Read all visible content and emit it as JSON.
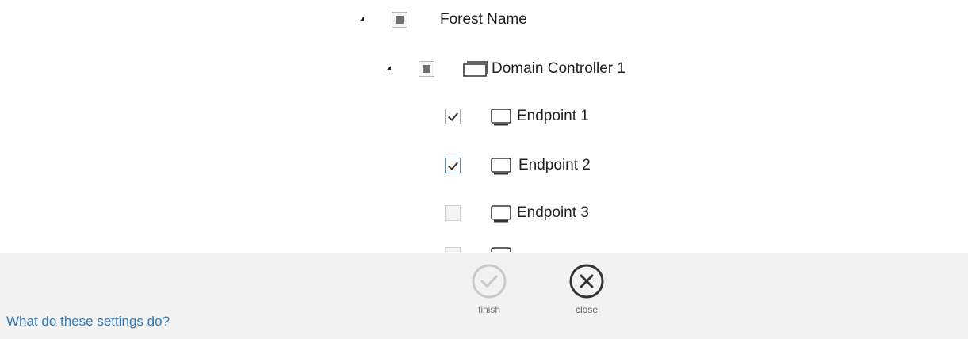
{
  "tree": {
    "forest": {
      "label": "Forest Name",
      "expanded": true,
      "state": "partial"
    },
    "domain_controller": {
      "label": "Domain Controller 1",
      "expanded": true,
      "state": "partial",
      "icon": "folder-icon"
    },
    "endpoints": [
      {
        "label": "Endpoint 1",
        "state": "checked",
        "icon": "computer-icon"
      },
      {
        "label": "Endpoint 2",
        "state": "checked",
        "icon": "computer-icon"
      },
      {
        "label": "Endpoint 3",
        "state": "unchecked",
        "icon": "computer-icon"
      }
    ]
  },
  "footer": {
    "help_link": "What do these settings do?",
    "finish_label": "finish",
    "close_label": "close",
    "finish_enabled": false
  }
}
